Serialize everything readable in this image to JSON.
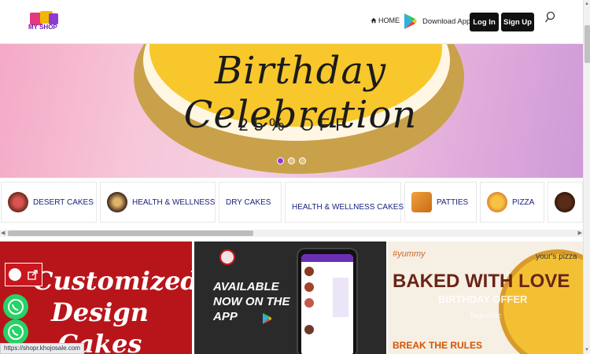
{
  "header": {
    "logo_text": "MY SHOP",
    "home_label": "HOME",
    "download_label": "Download App",
    "login_label": "Log In",
    "signup_label": "Sign Up"
  },
  "hero": {
    "title": "Birthday Celebration",
    "offer": "25% OFF",
    "slides": 3,
    "active_slide": 1
  },
  "categories": [
    {
      "label": "DESERT CAKES",
      "icon": "desert-cake-icon"
    },
    {
      "label": "HEALTH & WELLNESS",
      "icon": "health-cake-icon"
    },
    {
      "label": "DRY CAKES",
      "icon": ""
    },
    {
      "label": "HEALTH & WELLNESS CAKES",
      "icon": ""
    },
    {
      "label": "PATTIES",
      "icon": "patty-icon"
    },
    {
      "label": "PIZZA",
      "icon": "pizza-icon"
    }
  ],
  "banners": {
    "b1": {
      "text": "Customized Design Cakes"
    },
    "b2": {
      "text": "AVAILABLE NOW ON THE APP"
    },
    "b3": {
      "tag": "#yummy",
      "headline": "BAKED WITH LOVE",
      "overlay": "BIRTHDAY OFFER",
      "sub": "Republic",
      "footer": "BREAK THE RULES",
      "brand": "your's pizza"
    }
  },
  "status_url": "https://shopr.khojosale.com",
  "colors": {
    "accent": "#8e3bd4",
    "dark_button": "#111111",
    "category_text": "#1a237e"
  }
}
